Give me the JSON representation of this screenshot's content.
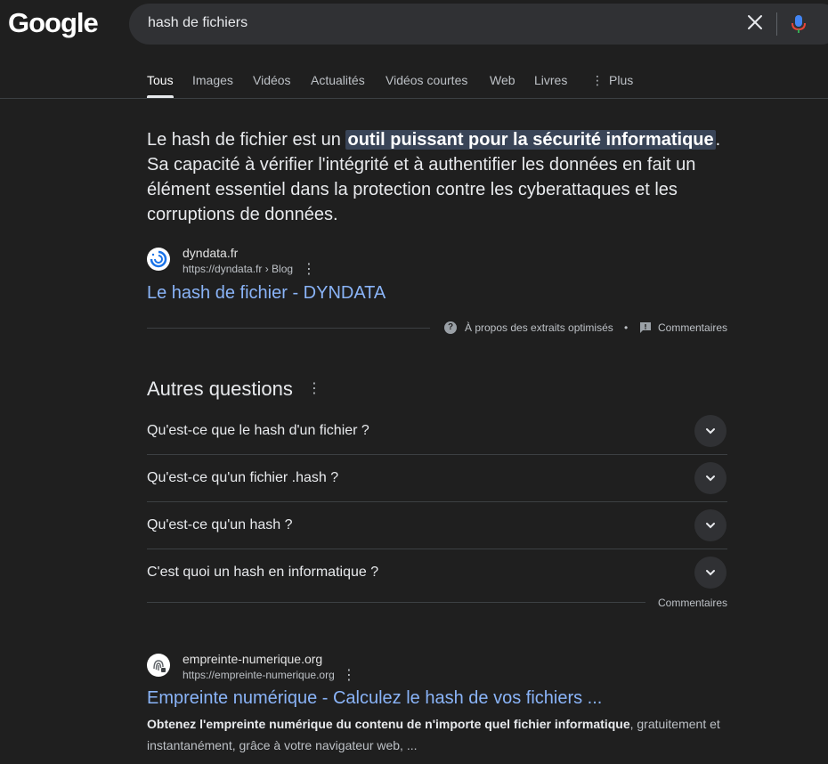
{
  "header": {
    "logo_text": "Google",
    "search_value": "hash de fichiers"
  },
  "tabs": [
    {
      "label": "Tous",
      "active": true
    },
    {
      "label": "Images"
    },
    {
      "label": "Vidéos"
    },
    {
      "label": "Actualités"
    },
    {
      "label": "Vidéos courtes"
    },
    {
      "label": "Web"
    },
    {
      "label": "Livres"
    },
    {
      "label": "Plus"
    }
  ],
  "snippet": {
    "text_before": "Le hash de fichier est un ",
    "highlight": "outil puissant pour la sécurité informatique",
    "text_after": ". Sa capacité à vérifier l'intégrité et à authentifier les données en fait un élément essentiel dans la protection contre les cyberattaques et les corruptions de données.",
    "site_name": "dyndata.fr",
    "site_url": "https://dyndata.fr › Blog",
    "link_title": "Le hash de fichier - DYNDATA",
    "about_label": "À propos des extraits optimisés",
    "separator": "•",
    "feedback_label": "Commentaires"
  },
  "paa": {
    "title": "Autres questions",
    "questions": [
      "Qu'est-ce que le hash d'un fichier ?",
      "Qu'est-ce qu'un fichier .hash ?",
      "Qu'est-ce qu'un hash ?",
      "C'est quoi un hash en informatique ?"
    ],
    "feedback_label": "Commentaires"
  },
  "result": {
    "site_name": "empreinte-numerique.org",
    "site_url": "https://empreinte-numerique.org",
    "link_title": "Empreinte numérique - Calculez le hash de vos fichiers ...",
    "desc_bold": "Obtenez l'empreinte numérique du contenu de n'importe quel fichier informatique",
    "desc_rest": ", gratuitement et instantanément, grâce à votre navigateur web, ..."
  },
  "colors": {
    "background": "#1f1f1f",
    "link": "#8ab4f8",
    "highlight_bg": "#394457"
  }
}
